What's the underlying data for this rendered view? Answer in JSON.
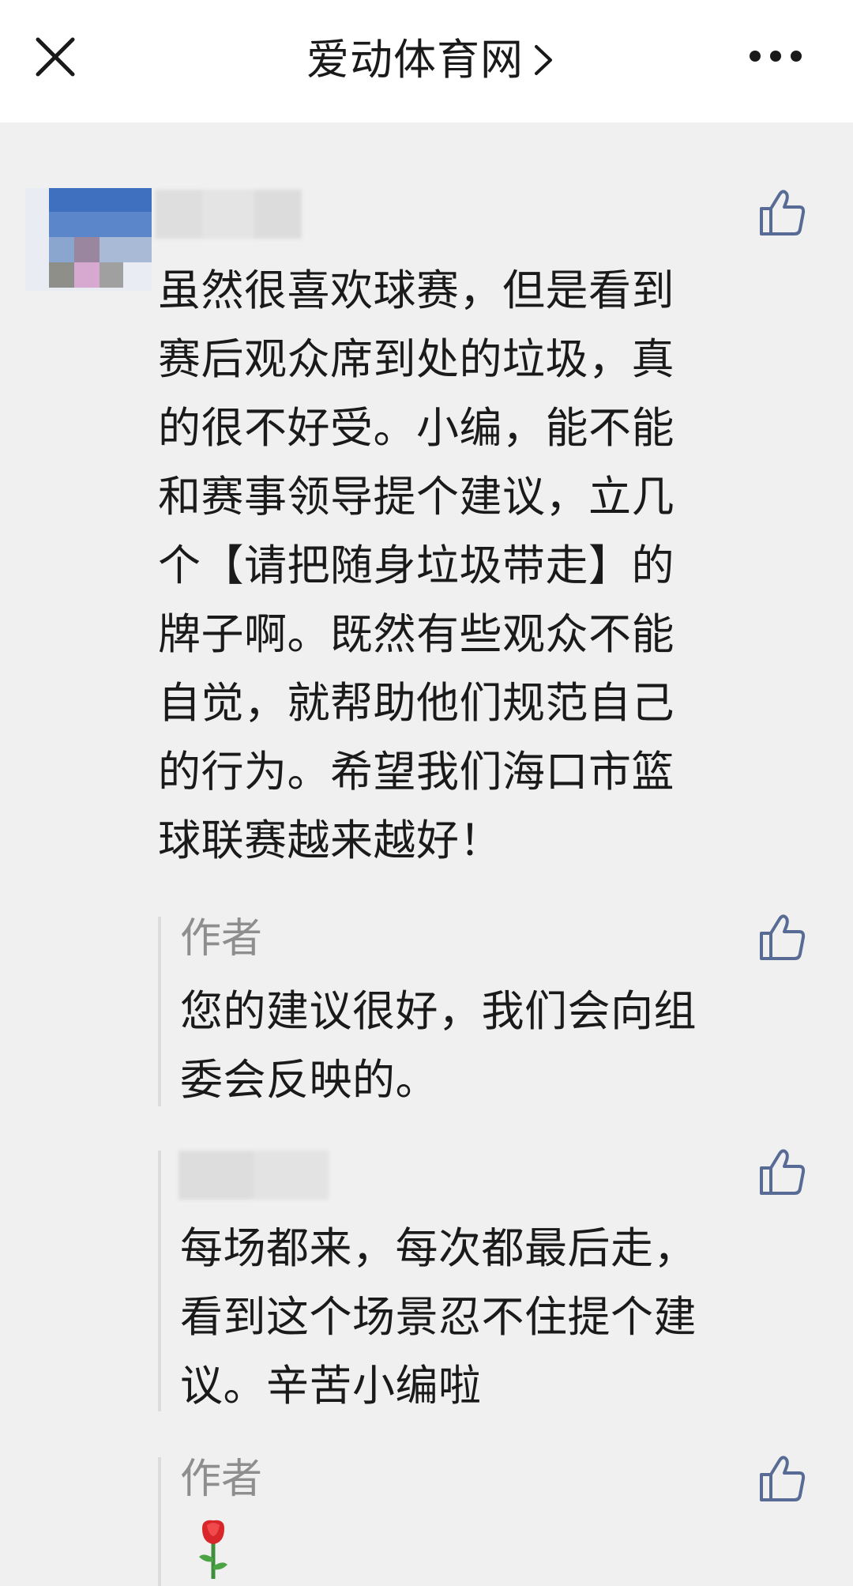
{
  "header": {
    "title": "爱动体育网",
    "close_icon": "close-icon",
    "chevron_icon": "chevron-right-icon",
    "more_icon": "more-horizontal-icon"
  },
  "comment": {
    "lines": [
      "虽然很喜欢球赛，但是看到",
      "赛后观众席到处的垃圾，真",
      "的很不好受。小编，能不能",
      "和赛事领导提个建议，立几",
      "个【请把随身垃圾带走】的",
      "牌子啊。既然有些观众不能",
      "自觉，就帮助他们规范自己",
      "的行为。希望我们海口市篮",
      "球联赛越来越好！"
    ]
  },
  "replies": [
    {
      "author": "作者",
      "lines": [
        "您的建议很好，我们会向组",
        "委会反映的。"
      ]
    },
    {
      "author": "",
      "lines": [
        "每场都来，每次都最后走，",
        "看到这个场景忍不住提个建",
        "议。辛苦小编啦"
      ]
    },
    {
      "author": "作者",
      "emoji": "rose-icon"
    }
  ],
  "icons": {
    "like": "thumbs-up-icon"
  },
  "colors": {
    "accent": "#576b95",
    "background": "#f0f0f0",
    "muted": "#8e8e8e"
  }
}
